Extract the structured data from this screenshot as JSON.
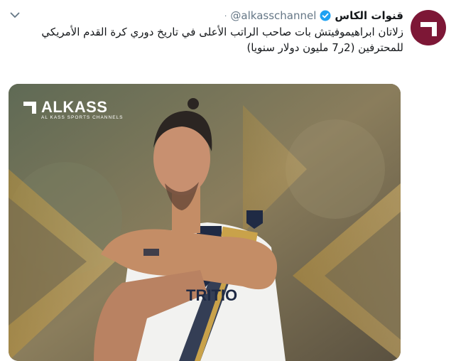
{
  "account": {
    "display_name": "قنوات الكاس",
    "handle": "@alkasschannel",
    "separator": "·"
  },
  "tweet": {
    "text": "زلاتان ابراهيموفيتش بات صاحب الراتب الأعلى في تاريخ دوري كرة القدم الأمريكي للمحترفين (2ر7 مليون دولار سنويا)"
  },
  "media": {
    "logo_text": "ALKASS",
    "logo_subtext": "AL KASS SPORTS CHANNELS",
    "jersey_text": "TRITIO"
  },
  "colors": {
    "avatar_bg": "#7d1736",
    "verified": "#1da1f2",
    "text": "#14171a",
    "muted": "#657786",
    "gold": "#c9a24a"
  },
  "icons": [
    "alkass-avatar-icon",
    "verified-badge-icon",
    "chevron-down-icon",
    "alkass-logo-icon"
  ]
}
